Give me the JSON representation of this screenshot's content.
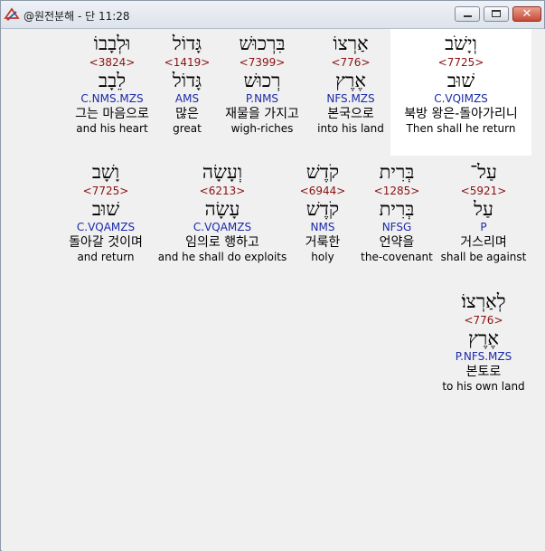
{
  "window": {
    "title": "@원전분해 - 단 11:28",
    "minimize_label": "",
    "maximize_label": "",
    "close_label": "✕"
  },
  "words": [
    {
      "heb": "וְיָשֹׁב",
      "strong": "<7725>",
      "lex": "שׁוּב",
      "parse": "C.VQIMZS",
      "kor": "북방 왕은-돌아가리니",
      "eng": "Then shall he return",
      "highlight": true
    },
    {
      "heb": "אַרְצוֹ",
      "strong": "<776>",
      "lex": "אֶרֶץ",
      "parse": "NFS.MZS",
      "kor": "본국으로",
      "eng": "into his land"
    },
    {
      "heb": "בִּרְכוּשׁ",
      "strong": "<7399>",
      "lex": "רְכוּשׁ",
      "parse": "P.NMS",
      "kor": "재물을 가지고",
      "eng": "wigh-riches"
    },
    {
      "heb": "גָּדוֹל",
      "strong": "<1419>",
      "lex": "גָּדוֹל",
      "parse": "AMS",
      "kor": "많은",
      "eng": "great"
    },
    {
      "heb": "וּלְבָבוֹ",
      "strong": "<3824>",
      "lex": "לֵבָב",
      "parse": "C.NMS.MZS",
      "kor": "그는 마음으로",
      "eng": "and his heart"
    },
    {
      "heb": "עַל־",
      "strong": "<5921>",
      "lex": "עַל",
      "parse": "P",
      "kor": "거스리며",
      "eng": "shall be against"
    },
    {
      "heb": "בְּרִית",
      "strong": "<1285>",
      "lex": "בְּרִית",
      "parse": "NFSG",
      "kor": "언약을",
      "eng": "the-covenant"
    },
    {
      "heb": "קֹדֶשׁ",
      "strong": "<6944>",
      "lex": "קֹדֶשׁ",
      "parse": "NMS",
      "kor": "거룩한",
      "eng": "holy"
    },
    {
      "heb": "וְעָשָׂה",
      "strong": "<6213>",
      "lex": "עָשָׂה",
      "parse": "C.VQAMZS",
      "kor": "임의로 행하고",
      "eng": "and he shall do exploits"
    },
    {
      "heb": "וָשָׁב",
      "strong": "<7725>",
      "lex": "שׁוּב",
      "parse": "C.VQAMZS",
      "kor": "돌아갈 것이며",
      "eng": "and return"
    },
    {
      "heb": "לְאַרְצוֹ׃",
      "strong": "<776>",
      "lex": "אֶרֶץ",
      "parse": "P.NFS.MZS",
      "kor": "본토로",
      "eng": "to his own land"
    }
  ]
}
